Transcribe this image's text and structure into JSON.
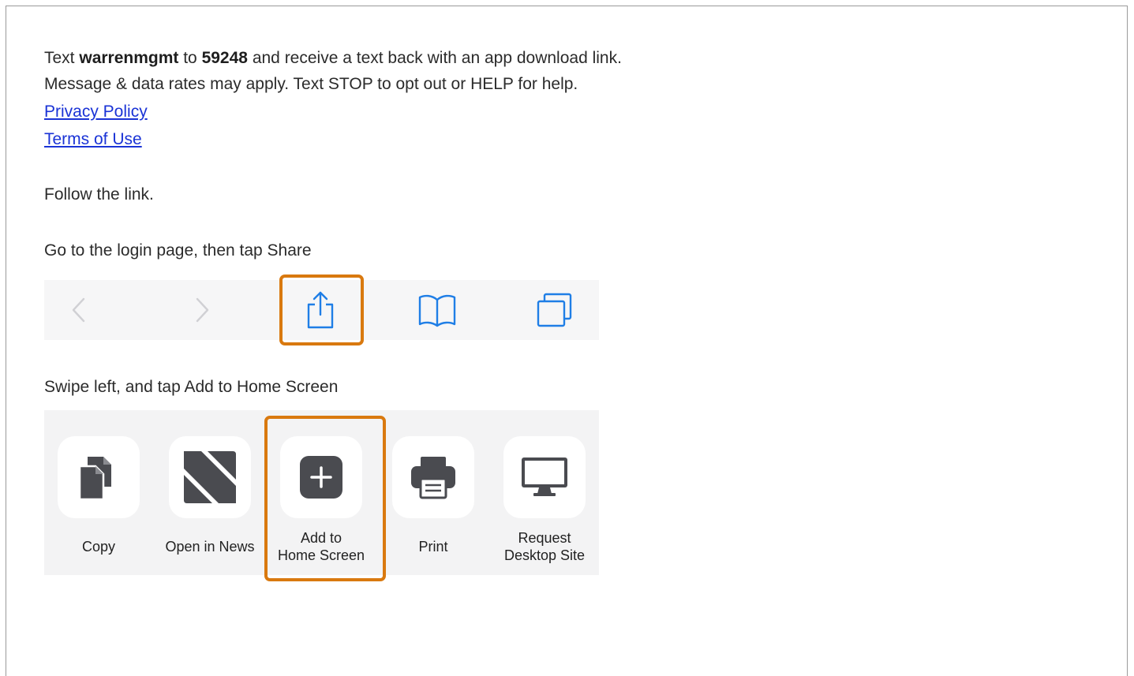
{
  "instructions": {
    "line1": {
      "prefix": "Text ",
      "keyword": "warrenmgmt",
      "middle": " to ",
      "shortcode": "59248",
      "suffix": " and receive a text back with an app download link."
    },
    "line2": "Message & data rates may apply. Text STOP to opt out or HELP for help.",
    "privacy_link": "Privacy Policy",
    "terms_link": "Terms of Use",
    "step1": "Follow the link.",
    "step2": "Go to the login page, then tap Share",
    "step3": "Swipe left, and tap Add to Home Screen"
  },
  "toolbar": {
    "buttons": [
      "back-icon",
      "forward-icon",
      "share-icon",
      "bookmarks-icon",
      "tabs-icon"
    ],
    "highlighted": "share-icon"
  },
  "share_sheet": {
    "actions": [
      {
        "label": "Copy",
        "icon": "copy-icon"
      },
      {
        "label": "Open in News",
        "icon": "news-icon"
      },
      {
        "label": "Add to\nHome Screen",
        "icon": "add-to-home-icon"
      },
      {
        "label": "Print",
        "icon": "print-icon"
      },
      {
        "label": "Request\nDesktop Site",
        "icon": "desktop-icon"
      }
    ],
    "highlighted": "Add to Home Screen"
  },
  "colors": {
    "highlight": "#d9790f",
    "link": "#1a33d6",
    "ios_blue": "#1f7ee6",
    "icon_dark": "#4a4b50"
  }
}
